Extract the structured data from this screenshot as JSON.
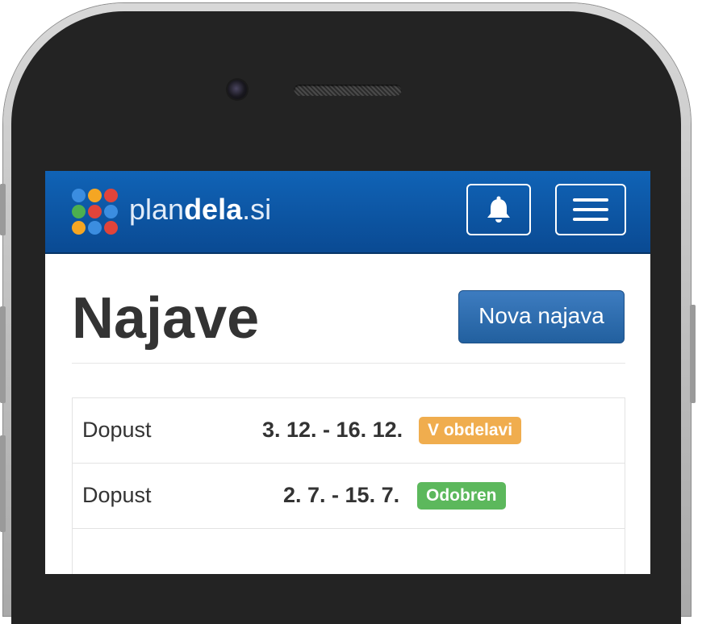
{
  "app": {
    "brand_light": "plan",
    "brand_bold": "dela",
    "brand_suffix": ".si",
    "logo_colors": [
      "#3b8de0",
      "#f5a623",
      "#e0443a",
      "#4caf50",
      "#e0443a",
      "#3b8de0",
      "#f5a623",
      "#3b8de0",
      "#e0443a"
    ]
  },
  "header": {
    "notifications_icon": "bell-icon",
    "menu_icon": "hamburger-icon"
  },
  "page": {
    "title": "Najave",
    "new_button_label": "Nova najava"
  },
  "requests": [
    {
      "type": "Dopust",
      "dates": "3. 12. - 16. 12.",
      "status": "V obdelavi",
      "status_color": "#f0ad4e"
    },
    {
      "type": "Dopust",
      "dates": "2. 7. - 15. 7.",
      "status": "Odobren",
      "status_color": "#5cb85c"
    }
  ],
  "colors": {
    "navbar": "#0a4a93",
    "primary_button": "#2a6aaf",
    "pending": "#f0ad4e",
    "approved": "#5cb85c"
  }
}
